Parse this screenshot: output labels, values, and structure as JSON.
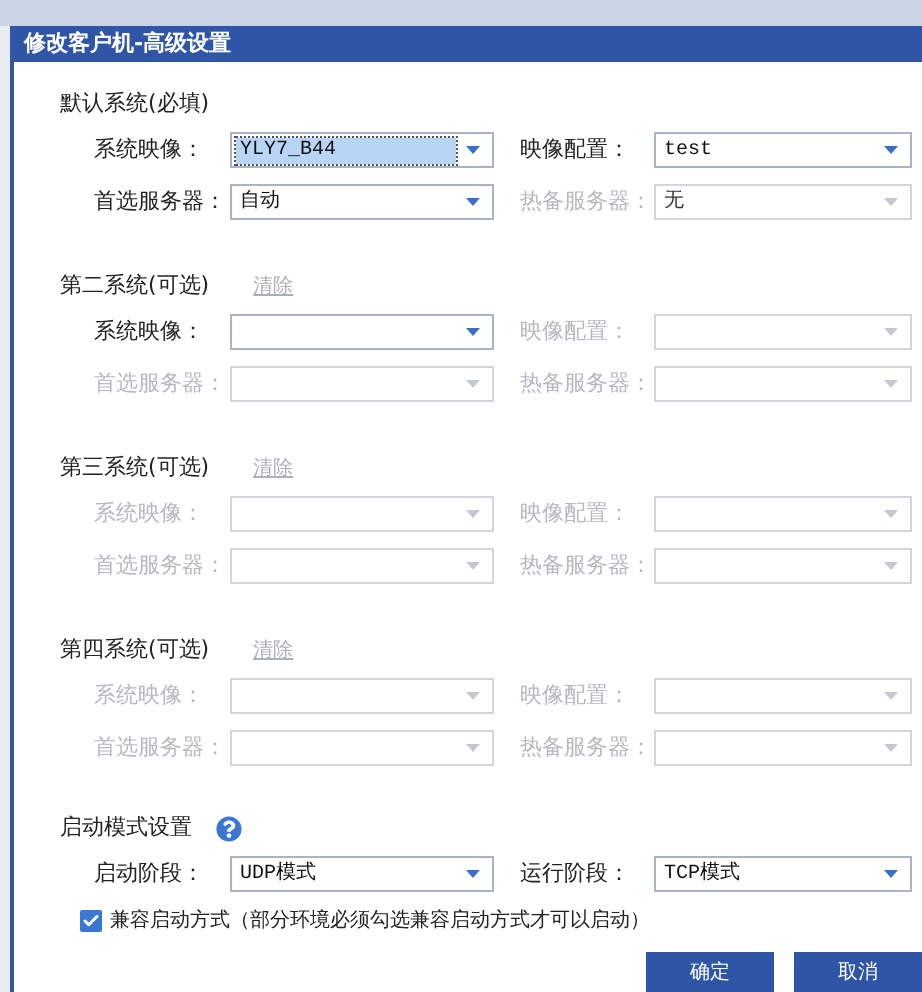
{
  "dialog": {
    "title": "修改客户机-高级设置"
  },
  "systems": [
    {
      "title": "默认系统(必填)",
      "fields": [
        {
          "label": "系统映像：",
          "value": "YLY7_B44",
          "disabled": false,
          "highlighted": true
        },
        {
          "label": "映像配置：",
          "value": "test",
          "disabled": false,
          "highlighted": false
        },
        {
          "label": "首选服务器：",
          "value": "自动",
          "disabled": false,
          "highlighted": false
        },
        {
          "label": "热备服务器：",
          "value": "无",
          "disabled": true,
          "highlighted": false
        }
      ]
    },
    {
      "title": "第二系统(可选)",
      "clear": "清除",
      "fields": [
        {
          "label": "系统映像：",
          "disabled": false
        },
        {
          "label": "映像配置：",
          "disabled": true
        },
        {
          "label": "首选服务器：",
          "disabled": true
        },
        {
          "label": "热备服务器：",
          "disabled": true
        }
      ]
    },
    {
      "title": "第三系统(可选)",
      "clear": "清除",
      "fields": [
        {
          "label": "系统映像：",
          "disabled": true
        },
        {
          "label": "映像配置：",
          "disabled": true
        },
        {
          "label": "首选服务器：",
          "disabled": true
        },
        {
          "label": "热备服务器：",
          "disabled": true
        }
      ]
    },
    {
      "title": "第四系统(可选)",
      "clear": "清除",
      "fields": [
        {
          "label": "系统映像：",
          "disabled": true
        },
        {
          "label": "映像配置：",
          "disabled": true
        },
        {
          "label": "首选服务器：",
          "disabled": true
        },
        {
          "label": "热备服务器：",
          "disabled": true
        }
      ]
    }
  ],
  "boot": {
    "title": "启动模式设置",
    "fields": [
      {
        "label": "启动阶段：",
        "value": "UDP模式",
        "disabled": false,
        "highlighted": false
      },
      {
        "label": "运行阶段：",
        "value": "TCP模式",
        "disabled": false,
        "highlighted": false
      }
    ],
    "compat": {
      "label": "兼容启动方式（部分环境必须勾选兼容启动方式才可以启动）",
      "checked": true
    }
  },
  "buttons": [
    {
      "label": "确定"
    },
    {
      "label": "取消"
    }
  ]
}
